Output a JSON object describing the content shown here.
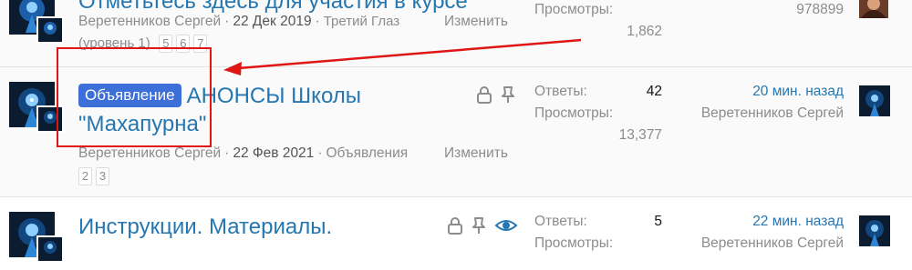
{
  "threads": [
    {
      "title": "Отметьтесь здесь для участия в курсе",
      "author": "Веретенников Сергей",
      "date": "22 Дек 2019",
      "forum": "Третий Глаз (уровень 1)",
      "edit": "Изменить",
      "pages": [
        "5",
        "6",
        "7"
      ],
      "stats": {
        "views_label": "Просмотры:",
        "views_value": "1,862"
      },
      "last_user_value": "978899"
    },
    {
      "prefix": "Объявление",
      "title": "АНОНСЫ Школы \"Махапурна\"",
      "author": "Веретенников Сергей",
      "date": "22 Фев 2021",
      "forum": "Объявления",
      "edit": "Изменить",
      "pages": [
        "2",
        "3"
      ],
      "stats": {
        "replies_label": "Ответы:",
        "replies_value": "42",
        "views_label": "Просмотры:",
        "views_value": "13,377"
      },
      "last_time": "20 мин. назад",
      "last_user": "Веретенников Сергей"
    },
    {
      "title": "Инструкции. Материалы.",
      "stats": {
        "replies_label": "Ответы:",
        "replies_value": "5",
        "views_label": "Просмотры:"
      },
      "last_time": "22 мин. назад",
      "last_user": "Веретенников Сергей"
    }
  ],
  "icons": {
    "lock": "lock-icon",
    "pin": "pin-icon",
    "watch": "eye-icon"
  },
  "colors": {
    "link": "#2577b1",
    "prefix": "#3d6fd8",
    "annotation": "#e01515"
  }
}
